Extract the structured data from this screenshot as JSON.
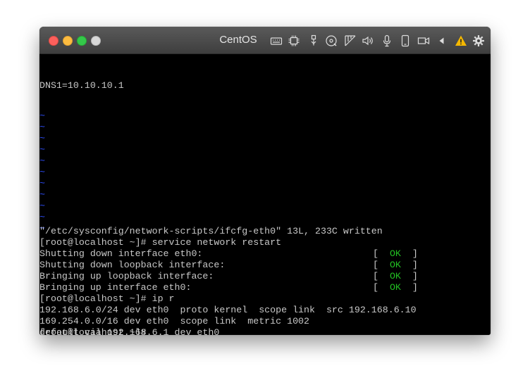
{
  "window": {
    "title": "CentOS",
    "toolbar_icons": [
      "keyboard-icon",
      "cpu-icon",
      "usb-icon",
      "cd-disc-icon",
      "network-icon",
      "audio-icon",
      "microphone-icon",
      "phone-icon",
      "camera-icon",
      "back-arrow-icon",
      "warning-icon",
      "gear-icon"
    ],
    "colors": {
      "close": "#fc605c",
      "minimize": "#fdbc40",
      "maximize": "#34c84a",
      "warning": "#f5b800"
    }
  },
  "terminal": {
    "colors": {
      "text": "#c8c8c8",
      "ok": "#22c022",
      "tilde": "#3050ff",
      "background": "#000000"
    },
    "dns_line": "DNS1=10.10.10.1",
    "tilde": "~",
    "vi_status": "\"/etc/sysconfig/network-scripts/ifcfg-eth0\" 13L, 233C written",
    "cmd_restart": "[root@localhost ~]# service network restart",
    "restart_lines": [
      {
        "text": "Shutting down interface eth0:",
        "open": "[  ",
        "ok": "OK",
        "close": "  ]"
      },
      {
        "text": "Shutting down loopback interface:",
        "open": "[  ",
        "ok": "OK",
        "close": "  ]"
      },
      {
        "text": "Bringing up loopback interface:",
        "open": "[  ",
        "ok": "OK",
        "close": "  ]"
      },
      {
        "text": "Bringing up interface eth0:",
        "open": "[  ",
        "ok": "OK",
        "close": "  ]"
      }
    ],
    "cmd_ip": "[root@localhost ~]# ip r",
    "routes": [
      "192.168.6.0/24 dev eth0  proto kernel  scope link  src 192.168.6.10",
      "169.254.0.0/16 dev eth0  scope link  metric 1002",
      "default via 192.168.6.1 dev eth0"
    ],
    "prompt": "[root@localhost ~]# "
  }
}
